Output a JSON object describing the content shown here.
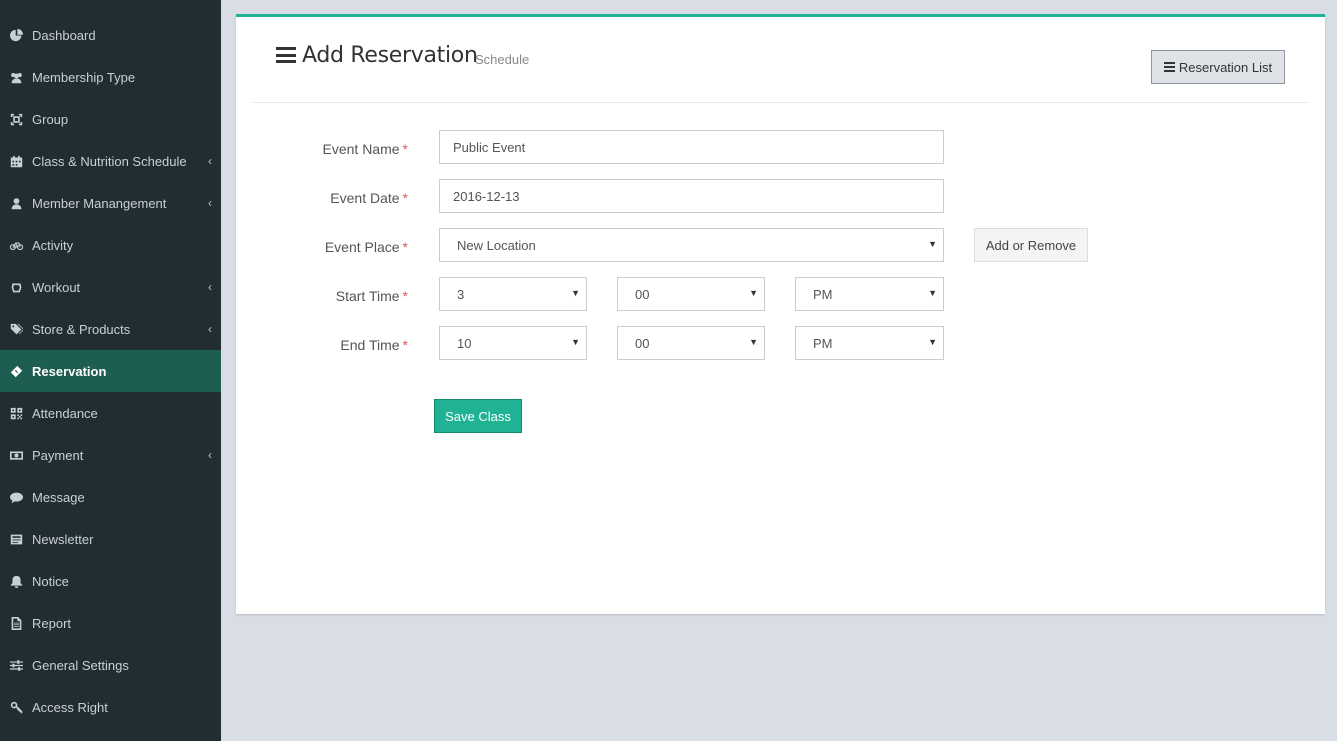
{
  "sidebar": {
    "items": [
      {
        "label": "Dashboard",
        "icon": "dashboard-icon",
        "chevron": false,
        "active": false
      },
      {
        "label": "Membership Type",
        "icon": "users-icon",
        "chevron": false,
        "active": false
      },
      {
        "label": "Group",
        "icon": "group-icon",
        "chevron": false,
        "active": false
      },
      {
        "label": "Class & Nutrition Schedule",
        "icon": "calendar-icon",
        "chevron": true,
        "active": false
      },
      {
        "label": "Member Manangement",
        "icon": "user-icon",
        "chevron": true,
        "active": false
      },
      {
        "label": "Activity",
        "icon": "bicycle-icon",
        "chevron": false,
        "active": false
      },
      {
        "label": "Workout",
        "icon": "workout-icon",
        "chevron": true,
        "active": false
      },
      {
        "label": "Store & Products",
        "icon": "tags-icon",
        "chevron": true,
        "active": false
      },
      {
        "label": "Reservation",
        "icon": "ticket-icon",
        "chevron": false,
        "active": true
      },
      {
        "label": "Attendance",
        "icon": "qrcode-icon",
        "chevron": false,
        "active": false
      },
      {
        "label": "Payment",
        "icon": "money-icon",
        "chevron": true,
        "active": false
      },
      {
        "label": "Message",
        "icon": "comment-icon",
        "chevron": false,
        "active": false
      },
      {
        "label": "Newsletter",
        "icon": "newsletter-icon",
        "chevron": false,
        "active": false
      },
      {
        "label": "Notice",
        "icon": "bell-icon",
        "chevron": false,
        "active": false
      },
      {
        "label": "Report",
        "icon": "file-icon",
        "chevron": false,
        "active": false
      },
      {
        "label": "General Settings",
        "icon": "sliders-icon",
        "chevron": false,
        "active": false
      },
      {
        "label": "Access Right",
        "icon": "key-icon",
        "chevron": false,
        "active": false
      }
    ],
    "chevron_glyph": "‹"
  },
  "header": {
    "title": "Add Reservation",
    "subtitle": "Schedule",
    "list_button": "Reservation List"
  },
  "form": {
    "required_mark": "*",
    "event_name": {
      "label": "Event Name",
      "value": "Public Event"
    },
    "event_date": {
      "label": "Event Date",
      "value": "2016-12-13"
    },
    "event_place": {
      "label": "Event Place",
      "value": "New Location",
      "add_remove": "Add or Remove"
    },
    "start_time": {
      "label": "Start Time",
      "hour": "3",
      "minute": "00",
      "ampm": "PM"
    },
    "end_time": {
      "label": "End Time",
      "hour": "10",
      "minute": "00",
      "ampm": "PM"
    },
    "save_button": "Save Class",
    "caret_glyph": "▼"
  },
  "colors": {
    "accent": "#1fb394",
    "sidebar_bg": "#222d32",
    "sidebar_active_bg": "#1e5e52",
    "required": "#e25856"
  }
}
